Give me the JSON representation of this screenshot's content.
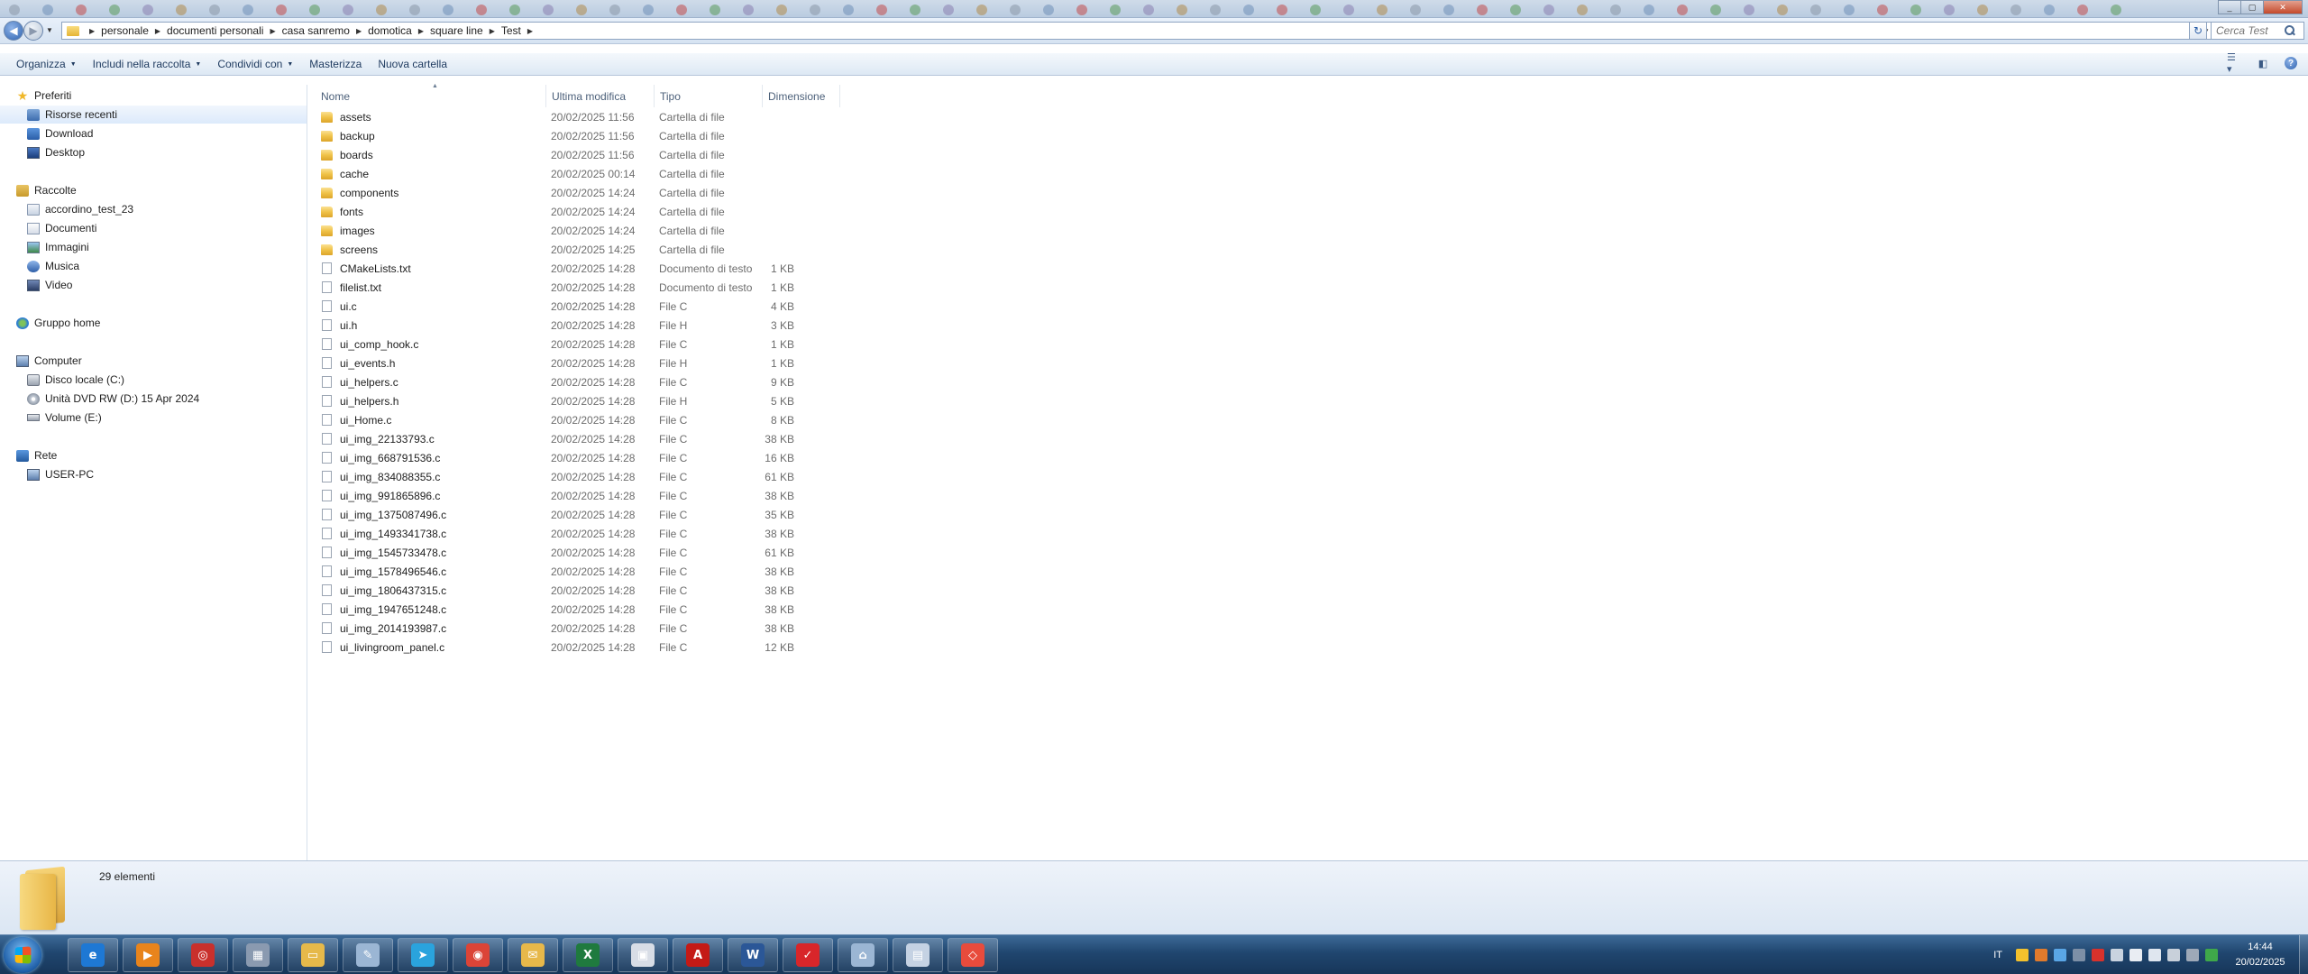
{
  "address": {
    "breadcrumbs": [
      "personale",
      "documenti personali",
      "casa sanremo",
      "domotica",
      "square line",
      "Test"
    ],
    "search_placeholder": "Cerca Test"
  },
  "toolbar": {
    "organize": "Organizza",
    "include_library": "Includi nella raccolta",
    "share": "Condividi con",
    "burn": "Masterizza",
    "new_folder": "Nuova cartella"
  },
  "nav": {
    "favorites": {
      "label": "Preferiti",
      "items": [
        "Risorse recenti",
        "Download",
        "Desktop"
      ]
    },
    "libraries": {
      "label": "Raccolte",
      "items": [
        "accordino_test_23",
        "Documenti",
        "Immagini",
        "Musica",
        "Video"
      ]
    },
    "homegroup": {
      "label": "Gruppo home"
    },
    "computer": {
      "label": "Computer",
      "items": [
        "Disco locale (C:)",
        "Unità DVD RW (D:) 15 Apr 2024",
        "Volume (E:)"
      ]
    },
    "network": {
      "label": "Rete",
      "items": [
        "USER-PC"
      ]
    }
  },
  "columns": {
    "name": "Nome",
    "modified": "Ultima modifica",
    "type": "Tipo",
    "size": "Dimensione"
  },
  "files": [
    {
      "name": "assets",
      "modified": "20/02/2025 11:56",
      "type": "Cartella di file",
      "size": "",
      "kind": "folder"
    },
    {
      "name": "backup",
      "modified": "20/02/2025 11:56",
      "type": "Cartella di file",
      "size": "",
      "kind": "folder"
    },
    {
      "name": "boards",
      "modified": "20/02/2025 11:56",
      "type": "Cartella di file",
      "size": "",
      "kind": "folder"
    },
    {
      "name": "cache",
      "modified": "20/02/2025 00:14",
      "type": "Cartella di file",
      "size": "",
      "kind": "folder"
    },
    {
      "name": "components",
      "modified": "20/02/2025 14:24",
      "type": "Cartella di file",
      "size": "",
      "kind": "folder"
    },
    {
      "name": "fonts",
      "modified": "20/02/2025 14:24",
      "type": "Cartella di file",
      "size": "",
      "kind": "folder"
    },
    {
      "name": "images",
      "modified": "20/02/2025 14:24",
      "type": "Cartella di file",
      "size": "",
      "kind": "folder"
    },
    {
      "name": "screens",
      "modified": "20/02/2025 14:25",
      "type": "Cartella di file",
      "size": "",
      "kind": "folder"
    },
    {
      "name": "CMakeLists.txt",
      "modified": "20/02/2025 14:28",
      "type": "Documento di testo",
      "size": "1 KB",
      "kind": "file"
    },
    {
      "name": "filelist.txt",
      "modified": "20/02/2025 14:28",
      "type": "Documento di testo",
      "size": "1 KB",
      "kind": "file"
    },
    {
      "name": "ui.c",
      "modified": "20/02/2025 14:28",
      "type": "File C",
      "size": "4 KB",
      "kind": "file"
    },
    {
      "name": "ui.h",
      "modified": "20/02/2025 14:28",
      "type": "File H",
      "size": "3 KB",
      "kind": "file"
    },
    {
      "name": "ui_comp_hook.c",
      "modified": "20/02/2025 14:28",
      "type": "File C",
      "size": "1 KB",
      "kind": "file"
    },
    {
      "name": "ui_events.h",
      "modified": "20/02/2025 14:28",
      "type": "File H",
      "size": "1 KB",
      "kind": "file"
    },
    {
      "name": "ui_helpers.c",
      "modified": "20/02/2025 14:28",
      "type": "File C",
      "size": "9 KB",
      "kind": "file"
    },
    {
      "name": "ui_helpers.h",
      "modified": "20/02/2025 14:28",
      "type": "File H",
      "size": "5 KB",
      "kind": "file"
    },
    {
      "name": "ui_Home.c",
      "modified": "20/02/2025 14:28",
      "type": "File C",
      "size": "8 KB",
      "kind": "file"
    },
    {
      "name": "ui_img_22133793.c",
      "modified": "20/02/2025 14:28",
      "type": "File C",
      "size": "38 KB",
      "kind": "file"
    },
    {
      "name": "ui_img_668791536.c",
      "modified": "20/02/2025 14:28",
      "type": "File C",
      "size": "16 KB",
      "kind": "file"
    },
    {
      "name": "ui_img_834088355.c",
      "modified": "20/02/2025 14:28",
      "type": "File C",
      "size": "61 KB",
      "kind": "file"
    },
    {
      "name": "ui_img_991865896.c",
      "modified": "20/02/2025 14:28",
      "type": "File C",
      "size": "38 KB",
      "kind": "file"
    },
    {
      "name": "ui_img_1375087496.c",
      "modified": "20/02/2025 14:28",
      "type": "File C",
      "size": "35 KB",
      "kind": "file"
    },
    {
      "name": "ui_img_1493341738.c",
      "modified": "20/02/2025 14:28",
      "type": "File C",
      "size": "38 KB",
      "kind": "file"
    },
    {
      "name": "ui_img_1545733478.c",
      "modified": "20/02/2025 14:28",
      "type": "File C",
      "size": "61 KB",
      "kind": "file"
    },
    {
      "name": "ui_img_1578496546.c",
      "modified": "20/02/2025 14:28",
      "type": "File C",
      "size": "38 KB",
      "kind": "file"
    },
    {
      "name": "ui_img_1806437315.c",
      "modified": "20/02/2025 14:28",
      "type": "File C",
      "size": "38 KB",
      "kind": "file"
    },
    {
      "name": "ui_img_1947651248.c",
      "modified": "20/02/2025 14:28",
      "type": "File C",
      "size": "38 KB",
      "kind": "file"
    },
    {
      "name": "ui_img_2014193987.c",
      "modified": "20/02/2025 14:28",
      "type": "File C",
      "size": "38 KB",
      "kind": "file"
    },
    {
      "name": "ui_livingroom_panel.c",
      "modified": "20/02/2025 14:28",
      "type": "File C",
      "size": "12 KB",
      "kind": "file"
    }
  ],
  "details": {
    "count": "29 elementi"
  },
  "taskbar": {
    "apps": [
      {
        "name": "internet-explorer-icon",
        "glyph": "e",
        "color": "#1e78d4"
      },
      {
        "name": "media-player-icon",
        "glyph": "▶",
        "color": "#e8841c"
      },
      {
        "name": "antivirus-icon",
        "glyph": "◎",
        "color": "#c9302c"
      },
      {
        "name": "calculator-icon",
        "glyph": "▦",
        "color": "#8a9ab0"
      },
      {
        "name": "explorer-icon",
        "glyph": "▭",
        "color": "#e6b94a"
      },
      {
        "name": "paint-tools-icon",
        "glyph": "✎",
        "color": "#9bb6d4"
      },
      {
        "name": "telegram-icon",
        "glyph": "➤",
        "color": "#2aa3dd"
      },
      {
        "name": "chrome-icon",
        "glyph": "◉",
        "color": "#db4437"
      },
      {
        "name": "messenger-icon",
        "glyph": "✉",
        "color": "#e7b84a"
      },
      {
        "name": "excel-icon",
        "glyph": "X",
        "color": "#1f7a3e"
      },
      {
        "name": "calendar-icon",
        "glyph": "▣",
        "color": "#d8dde6"
      },
      {
        "name": "acrobat-icon",
        "glyph": "A",
        "color": "#c41a16"
      },
      {
        "name": "word-icon",
        "glyph": "W",
        "color": "#2b5797"
      },
      {
        "name": "pdf-tool-icon",
        "glyph": "✓",
        "color": "#d8262a"
      },
      {
        "name": "remote-icon",
        "glyph": "⌂",
        "color": "#9bb6d4"
      },
      {
        "name": "presentation-icon",
        "glyph": "▤",
        "color": "#c5d2e3"
      },
      {
        "name": "vscode-ext-icon",
        "glyph": "◇",
        "color": "#e84b3c"
      }
    ],
    "language": "IT",
    "time": "14:44",
    "date": "20/02/2025"
  }
}
